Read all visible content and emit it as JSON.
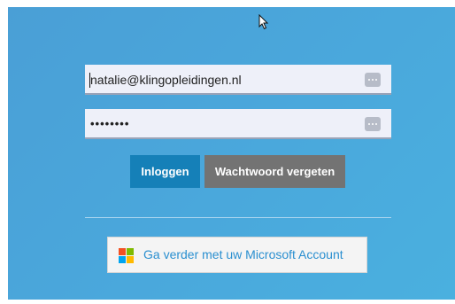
{
  "login": {
    "email_value": "natalie@klingopleidingen.nl",
    "password_value": "••••••••",
    "login_button": "Inloggen",
    "forgot_button": "Wachtwoord vergeten"
  },
  "microsoft": {
    "label": "Ga verder met uw Microsoft Account",
    "logo_colors": [
      "#f25022",
      "#7fba00",
      "#00a4ef",
      "#ffb900"
    ]
  },
  "colors": {
    "panel_background": "#4aa8dc",
    "login_button": "#1580b8",
    "forgot_button": "#737373"
  },
  "icons": {
    "field_menu": "more-horizontal-icon",
    "cursor": "mouse-pointer-icon"
  }
}
